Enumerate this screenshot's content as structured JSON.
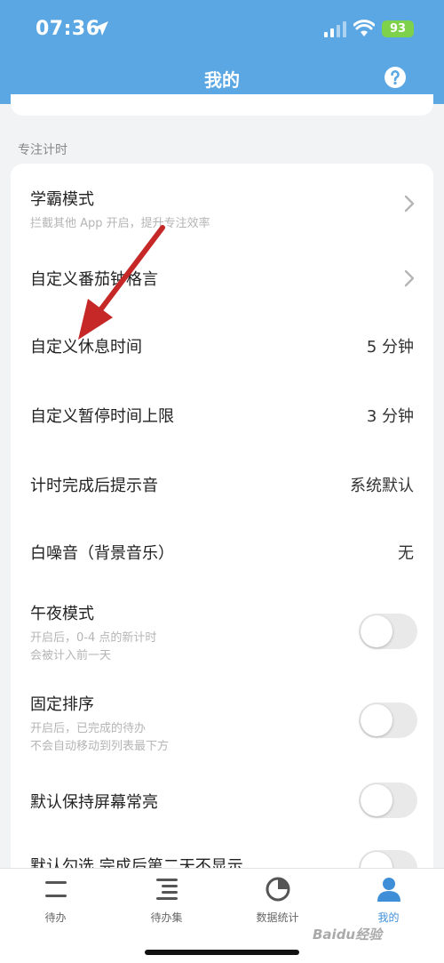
{
  "status_bar": {
    "time": "07:36",
    "battery": "93"
  },
  "header": {
    "title": "我的"
  },
  "section": {
    "label": "专注计时"
  },
  "rows": [
    {
      "title": "学霸模式",
      "subtitle": "拦截其他 App 开启，提升专注效率"
    },
    {
      "title": "自定义番茄钟格言"
    },
    {
      "title": "自定义休息时间",
      "value": "5 分钟"
    },
    {
      "title": "自定义暂停时间上限",
      "value": "3 分钟"
    },
    {
      "title": "计时完成后提示音",
      "value": "系统默认"
    },
    {
      "title": "白噪音（背景音乐）",
      "value": "无"
    },
    {
      "title": "午夜模式",
      "subtitle_lines": [
        "开启后，0-4 点的新计时",
        "会被计入前一天"
      ]
    },
    {
      "title": "固定排序",
      "subtitle_lines": [
        "开启后，已完成的待办",
        "不会自动移动到列表最下方"
      ]
    },
    {
      "title": "默认保持屏幕常亮"
    },
    {
      "title": "默认勾选 完成后第二天不显示"
    }
  ],
  "tabs": [
    {
      "label": "待办",
      "icon": "todo-icon"
    },
    {
      "label": "待办集",
      "icon": "list-icon"
    },
    {
      "label": "数据统计",
      "icon": "pie-chart-icon"
    },
    {
      "label": "我的",
      "icon": "user-icon"
    }
  ],
  "watermark": "Baidu经验",
  "colors": {
    "header": "#5aa7e3",
    "accent": "#3f8fd8",
    "annotation_arrow": "#c62828"
  }
}
